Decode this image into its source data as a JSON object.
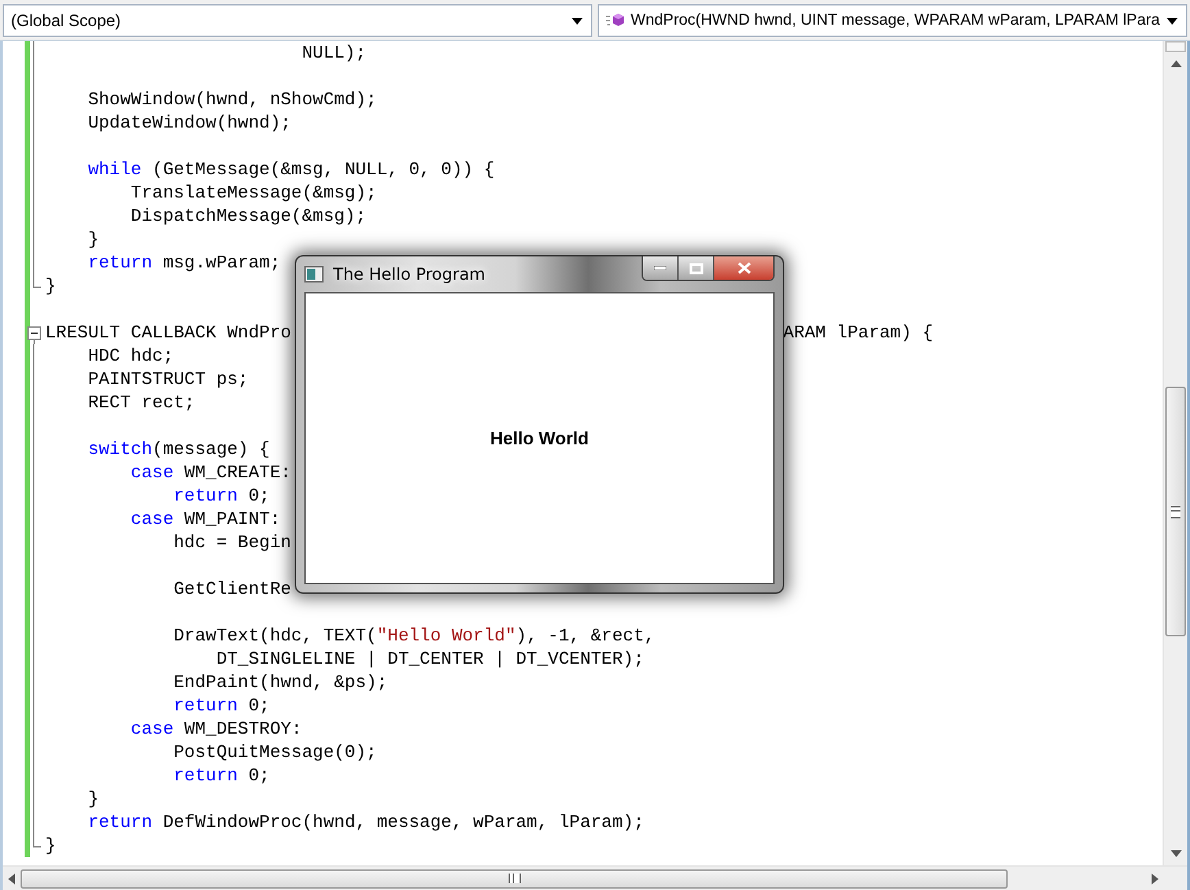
{
  "scope_dropdown": {
    "value": "(Global Scope)"
  },
  "member_dropdown": {
    "value": "WndProc(HWND hwnd, UINT message, WPARAM wParam, LPARAM lPara"
  },
  "code_blocks": [
    [
      {
        "segments": [
          {
            "kind": "plain",
            "text": "                        NULL);"
          }
        ]
      }
    ],
    [
      {
        "segments": [
          {
            "kind": "plain",
            "text": "    ShowWindow(hwnd, nShowCmd);"
          }
        ]
      },
      {
        "segments": [
          {
            "kind": "plain",
            "text": "    UpdateWindow(hwnd);"
          }
        ]
      }
    ],
    [
      {
        "segments": [
          {
            "kind": "keyword",
            "text": "    while"
          },
          {
            "kind": "plain",
            "text": " (GetMessage(&msg, NULL, 0, 0)) {"
          }
        ]
      },
      {
        "segments": [
          {
            "kind": "plain",
            "text": "        TranslateMessage(&msg);"
          }
        ]
      },
      {
        "segments": [
          {
            "kind": "plain",
            "text": "        DispatchMessage(&msg);"
          }
        ]
      },
      {
        "segments": [
          {
            "kind": "plain",
            "text": "    }"
          }
        ]
      },
      {
        "segments": [
          {
            "kind": "keyword",
            "text": "    return"
          },
          {
            "kind": "plain",
            "text": " msg.wParam;"
          }
        ]
      },
      {
        "segments": [
          {
            "kind": "plain",
            "text": "}"
          }
        ],
        "fold_end": true
      }
    ],
    [
      {
        "segments": [
          {
            "kind": "plain",
            "text": "LRESULT CALLBACK WndPro"
          }
        ],
        "fold_start": true,
        "tail": "ARAM lParam) {"
      },
      {
        "segments": [
          {
            "kind": "plain",
            "text": "    HDC hdc;"
          }
        ]
      },
      {
        "segments": [
          {
            "kind": "plain",
            "text": "    PAINTSTRUCT ps;"
          }
        ]
      },
      {
        "segments": [
          {
            "kind": "plain",
            "text": "    RECT rect;"
          }
        ]
      }
    ],
    [
      {
        "segments": [
          {
            "kind": "keyword",
            "text": "    switch"
          },
          {
            "kind": "plain",
            "text": "(message) {"
          }
        ]
      },
      {
        "segments": [
          {
            "kind": "keyword",
            "text": "        case"
          },
          {
            "kind": "plain",
            "text": " WM_CREATE:"
          }
        ]
      },
      {
        "segments": [
          {
            "kind": "keyword",
            "text": "            return"
          },
          {
            "kind": "plain",
            "text": " 0;"
          }
        ]
      },
      {
        "segments": [
          {
            "kind": "keyword",
            "text": "        case"
          },
          {
            "kind": "plain",
            "text": " WM_PAINT:"
          }
        ]
      },
      {
        "segments": [
          {
            "kind": "plain",
            "text": "            hdc = Begin"
          }
        ]
      }
    ],
    [
      {
        "segments": [
          {
            "kind": "plain",
            "text": "            GetClientRe"
          }
        ]
      }
    ],
    [
      {
        "segments": [
          {
            "kind": "plain",
            "text": "            DrawText(hdc, TEXT("
          },
          {
            "kind": "string",
            "text": "\"Hello World\""
          },
          {
            "kind": "plain",
            "text": "), -1, &rect,"
          }
        ]
      },
      {
        "segments": [
          {
            "kind": "plain",
            "text": "                DT_SINGLELINE | DT_CENTER | DT_VCENTER);"
          }
        ]
      },
      {
        "segments": [
          {
            "kind": "plain",
            "text": "            EndPaint(hwnd, &ps);"
          }
        ]
      },
      {
        "segments": [
          {
            "kind": "keyword",
            "text": "            return"
          },
          {
            "kind": "plain",
            "text": " 0;"
          }
        ]
      },
      {
        "segments": [
          {
            "kind": "keyword",
            "text": "        case"
          },
          {
            "kind": "plain",
            "text": " WM_DESTROY:"
          }
        ]
      },
      {
        "segments": [
          {
            "kind": "plain",
            "text": "            PostQuitMessage(0);"
          }
        ]
      },
      {
        "segments": [
          {
            "kind": "keyword",
            "text": "            return"
          },
          {
            "kind": "plain",
            "text": " 0;"
          }
        ]
      },
      {
        "segments": [
          {
            "kind": "plain",
            "text": "    }"
          }
        ]
      },
      {
        "segments": [
          {
            "kind": "keyword",
            "text": "    return"
          },
          {
            "kind": "plain",
            "text": " DefWindowProc(hwnd, message, wParam, lParam);"
          }
        ]
      },
      {
        "segments": [
          {
            "kind": "plain",
            "text": "}"
          }
        ],
        "fold_end": true
      }
    ]
  ],
  "program_window": {
    "title": "The Hello Program",
    "content": "Hello World"
  }
}
